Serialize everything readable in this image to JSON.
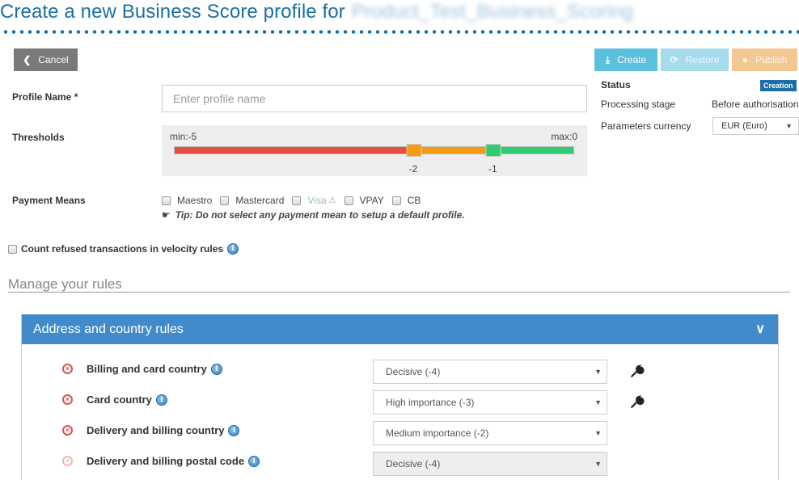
{
  "header": {
    "title": "Create a new Business Score profile for",
    "profile_target": "Product_Test_Business_Scoring"
  },
  "toolbar": {
    "cancel_label": "Cancel",
    "create_label": "Create",
    "restore_label": "Restore",
    "publish_label": "Publish"
  },
  "form": {
    "profile_name_label": "Profile Name *",
    "profile_name_value": "",
    "profile_name_placeholder": "Enter profile name",
    "thresholds_label": "Thresholds",
    "thresholds": {
      "min_label": "min:-5",
      "max_label": "max:0",
      "min": -5,
      "max": 0,
      "handles": [
        -2,
        -1
      ],
      "handle_labels": [
        "-2",
        "-1"
      ],
      "colors": {
        "red": "#e74c3c",
        "orange": "#f39c12",
        "green": "#2ecc71"
      }
    },
    "payment_means_label": "Payment Means",
    "payment_means": [
      {
        "label": "Maestro",
        "checked": false,
        "warning": false
      },
      {
        "label": "Mastercard",
        "checked": false,
        "warning": false
      },
      {
        "label": "Visa",
        "checked": false,
        "warning": true
      },
      {
        "label": "VPAY",
        "checked": false,
        "warning": false
      },
      {
        "label": "CB",
        "checked": false,
        "warning": false
      }
    ],
    "tip": "Tip: Do not select any payment mean to setup a default profile.",
    "count_refused_label": "Count refused transactions in velocity rules",
    "count_refused_checked": false
  },
  "info": {
    "status_label": "Status",
    "status_value": "Creation",
    "processing_stage_label": "Processing stage",
    "processing_stage_value": "Before authorisation",
    "currency_label": "Parameters currency",
    "currency_value": "EUR (Euro)"
  },
  "rules_section": {
    "title": "Manage your rules",
    "panel_title": "Address and country rules",
    "rules": [
      {
        "name": "Billing and card country",
        "value": "Decisive (-4)",
        "disabled": false,
        "has_settings": true
      },
      {
        "name": "Card country",
        "value": "High importance (-3)",
        "disabled": false,
        "has_settings": true
      },
      {
        "name": "Delivery and billing country",
        "value": "Medium importance (-2)",
        "disabled": false,
        "has_settings": false
      },
      {
        "name": "Delivery and billing postal code",
        "value": "Decisive (-4)",
        "disabled": true,
        "has_settings": false
      }
    ]
  },
  "colors": {
    "brand": "#1a6fa8",
    "panel_header": "#428bca",
    "create": "#5bc0de",
    "publish": "#f3c893",
    "remove": "#d9534f"
  }
}
